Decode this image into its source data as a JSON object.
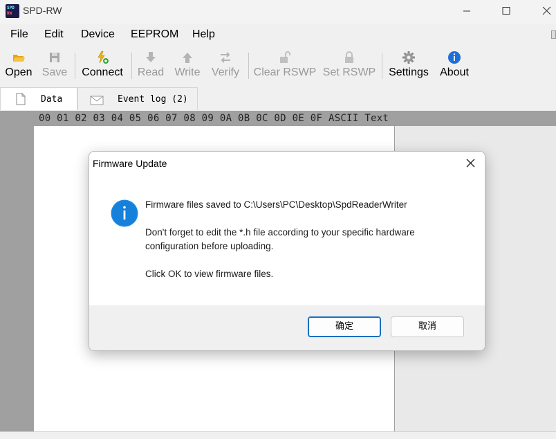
{
  "window": {
    "title": "SPD-RW",
    "app_icon_text_top": "SPD",
    "app_icon_text_bottom": "RW"
  },
  "menu": [
    "File",
    "Edit",
    "Device",
    "EEPROM",
    "Help"
  ],
  "toolbar": {
    "open": "Open",
    "save": "Save",
    "connect": "Connect",
    "read": "Read",
    "write": "Write",
    "verify": "Verify",
    "clear_rswp": "Clear RSWP",
    "set_rswp": "Set RSWP",
    "settings": "Settings",
    "about": "About"
  },
  "tabs": {
    "data": "Data",
    "event_log": "Event log (2)"
  },
  "hex_header": "00 01 02 03 04 05 06 07 08 09 0A 0B 0C 0D 0E 0F ASCII Text",
  "dialog": {
    "title": "Firmware Update",
    "line1": "Firmware files saved to C:\\Users\\PC\\Desktop\\SpdReaderWriter",
    "line2": "Don't forget to edit the *.h file according to your specific hardware",
    "line3": "configuration before uploading.",
    "line4": "Click OK to view firmware files.",
    "ok_label": "确定",
    "cancel_label": "取消"
  },
  "colors": {
    "accent": "#1a6fc1",
    "info_icon": "#1e88e5",
    "hex_background": "#a0a0a0"
  }
}
